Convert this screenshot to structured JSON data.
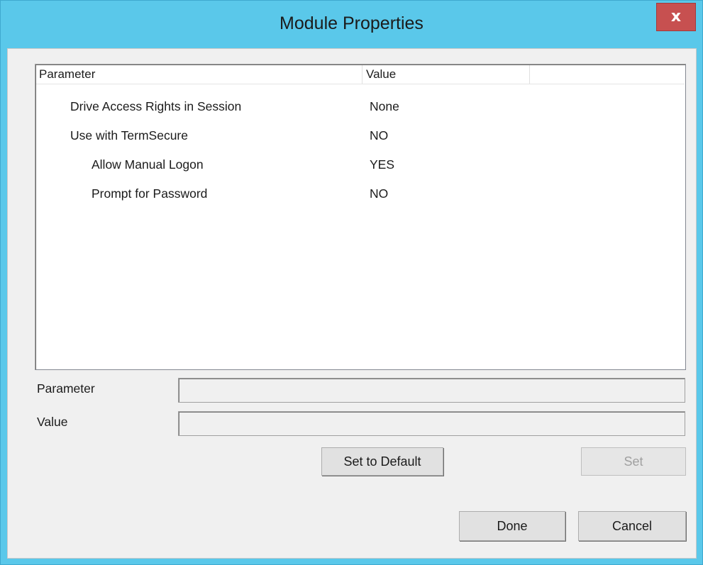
{
  "window": {
    "title": "Module Properties",
    "close_label": "x"
  },
  "listview": {
    "columns": [
      "Parameter",
      "Value",
      ""
    ],
    "rows": [
      {
        "parameter": "Drive Access Rights in Session",
        "value": "None",
        "indent": 1
      },
      {
        "parameter": "Use with TermSecure",
        "value": "NO",
        "indent": 1
      },
      {
        "parameter": "Allow Manual Logon",
        "value": "YES",
        "indent": 2
      },
      {
        "parameter": "Prompt for Password",
        "value": "NO",
        "indent": 2
      }
    ]
  },
  "form": {
    "parameter_label": "Parameter",
    "parameter_value": "",
    "value_label": "Value",
    "value_value": ""
  },
  "buttons": {
    "set_to_default": "Set to Default",
    "set": "Set",
    "done": "Done",
    "cancel": "Cancel"
  }
}
